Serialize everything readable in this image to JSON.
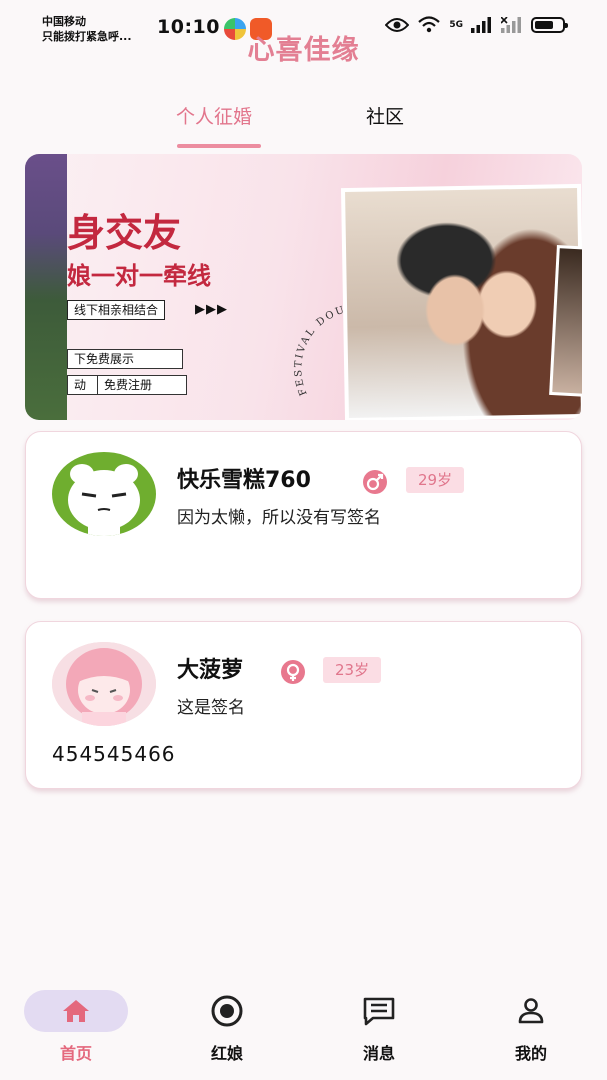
{
  "status_bar": {
    "carrier_line1": "中国移动",
    "carrier_line2": "只能拨打紧急呼...",
    "time": "10:10",
    "network_label": "5G"
  },
  "app": {
    "title": "心喜佳缘"
  },
  "tabs": [
    {
      "label": "个人征婚",
      "active": true
    },
    {
      "label": "社区",
      "active": false
    }
  ],
  "banner": {
    "title": "身交友",
    "subtitle": "娘一对一牵线",
    "bar_text": "线下相亲相结合",
    "arrows": "▶▶▶",
    "box1": "下免费展示",
    "box2": "动",
    "box3": "免费注册",
    "circle_text": "FESTIVAL DOUBLE SEVENTH"
  },
  "profiles": [
    {
      "name": "快乐雪糕760",
      "gender": "male",
      "age": "29岁",
      "signature": "因为太懒，所以没有写签名",
      "extra": ""
    },
    {
      "name": "大菠萝",
      "gender": "female",
      "age": "23岁",
      "signature": "这是签名",
      "extra": "454545466"
    }
  ],
  "bottom_nav": [
    {
      "label": "首页",
      "icon": "home-icon",
      "active": true
    },
    {
      "label": "红娘",
      "icon": "target-icon",
      "active": false
    },
    {
      "label": "消息",
      "icon": "message-icon",
      "active": false
    },
    {
      "label": "我的",
      "icon": "user-icon",
      "active": false
    }
  ],
  "colors": {
    "accent": "#e2758c",
    "age_badge_bg": "#fbdde4",
    "nav_active_pill": "#e3dbf2"
  }
}
